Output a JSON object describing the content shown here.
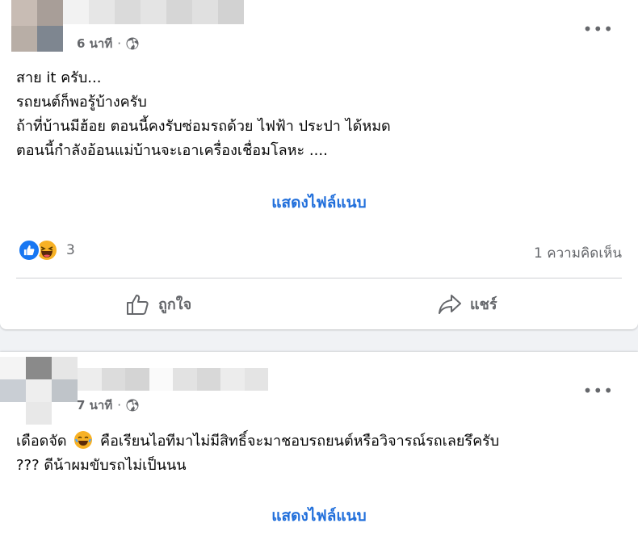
{
  "posts": [
    {
      "meta": {
        "time": "6 นาที",
        "separator": "·",
        "privacy_icon": "globe-icon"
      },
      "more_label": "•••",
      "lines": [
        "สาย it ครับ...",
        "รถยนต์ก็พอรู้บ้างครับ",
        "ถ้าที่บ้านมีฮ้อย ตอนนี้คงรับซ่อมรถด้วย ไฟฟ้า ประปา ได้หมด",
        "ตอนนี้กำลังอ้อนแม่บ้านจะเอาเครื่องเชื่อมโลหะ ...."
      ],
      "attachment_link": "แสดงไฟล์แนบ",
      "reactions": {
        "icons": [
          "like-icon",
          "haha-icon"
        ],
        "count": "3"
      },
      "comments": "1 ความคิดเห็น",
      "actions": {
        "like": "ถูกใจ",
        "share": "แชร์"
      }
    },
    {
      "meta": {
        "time": "7 นาที",
        "separator": "·",
        "privacy_icon": "globe-icon"
      },
      "more_label": "•••",
      "line1_before": "เดือดจัด",
      "line1_emoji": "crying-laughing-emoji",
      "line1_after": "คือเรียนไอทีมาไม่มีสิทธิ์จะมาชอบรถยนต์หรือวิจารณ์รถเลยรึครับ",
      "line2": "??? ดีน้าผมขับรถไม่เป็นนน",
      "attachment_link": "แสดงไฟล์แนบ"
    }
  ],
  "colors": {
    "link": "#216fdb",
    "secondary_text": "#65676b",
    "like_blue": "#1877f2",
    "haha_yellow": "#f7b125",
    "background": "#f0f2f5"
  }
}
